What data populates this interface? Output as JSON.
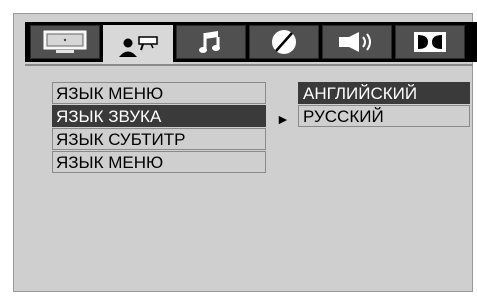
{
  "tabs": [
    {
      "icon": "tv-screen-icon"
    },
    {
      "icon": "person-settings-icon"
    },
    {
      "icon": "music-note-icon"
    },
    {
      "icon": "contrast-circle-icon"
    },
    {
      "icon": "speaker-icon"
    },
    {
      "icon": "dolby-icon"
    }
  ],
  "menu": {
    "items": [
      {
        "label": "ЯЗЫК МЕНЮ"
      },
      {
        "label": "ЯЗЫК ЗВУКА"
      },
      {
        "label": "ЯЗЫК СУБТИТР"
      },
      {
        "label": "ЯЗЫК МЕНЮ"
      }
    ]
  },
  "arrow": "►",
  "submenu": {
    "items": [
      {
        "label": "АНГЛИЙСКИЙ"
      },
      {
        "label": "РУССКИЙ"
      }
    ]
  }
}
